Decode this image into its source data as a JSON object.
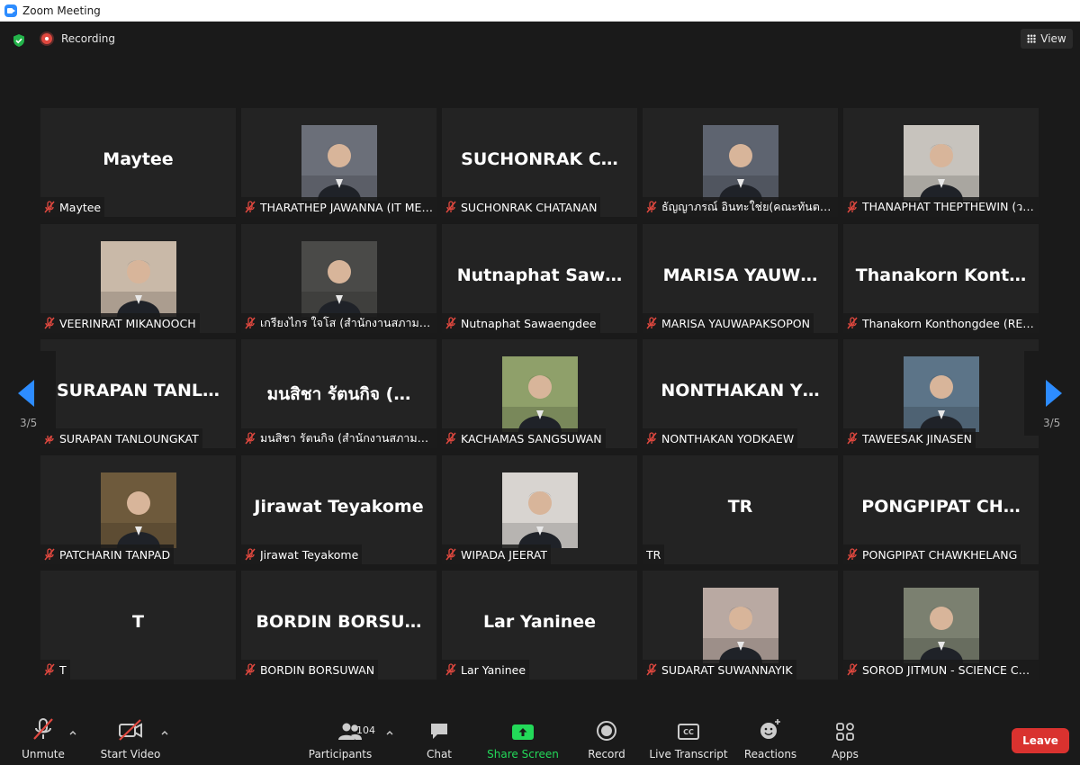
{
  "window": {
    "title": "Zoom Meeting"
  },
  "topbar": {
    "recording_label": "Recording",
    "view_label": "View"
  },
  "nav": {
    "page_left": "3/5",
    "page_right": "3/5"
  },
  "colors": {
    "accent": "#2D8CFF",
    "leave": "#d9322f",
    "mic_off": "#e0483f",
    "share": "#23d959"
  },
  "tiles": [
    {
      "display": "Maytee",
      "label": "Maytee"
    },
    {
      "display": "",
      "label": "THARATHEP JAWANNA (IT MED…",
      "photo": "#6b6f79"
    },
    {
      "display": "SUCHONRAK C…",
      "label": "SUCHONRAK CHATANAN"
    },
    {
      "display": "",
      "label": "ธัญญาภรณ์ อินทะใช่ย(คณะทันตแพ…",
      "photo": "#5e6470"
    },
    {
      "display": "",
      "label": "THANAPHAT THEPTHEWIN (วห…",
      "photo": "#c7c3bd"
    },
    {
      "display": "",
      "label": "VEERINRAT MIKANOOCH",
      "photo": "#c9b9a8"
    },
    {
      "display": "",
      "label": "เกรียงไกร ใจโส (สำนักงานสภามหาวิ…",
      "photo": "#4a4a48"
    },
    {
      "display": "Nutnaphat Saw…",
      "label": "Nutnaphat Sawaengdee"
    },
    {
      "display": "MARISA YAUW…",
      "label": "MARISA YAUWAPAKSOPON"
    },
    {
      "display": "Thanakorn Kont…",
      "label": "Thanakorn Konthongdee (REG)"
    },
    {
      "display": "SURAPAN TANL…",
      "label": "SURAPAN TANLOUNGKAT"
    },
    {
      "display": "มนสิชา รัตนกิจ (…",
      "label": "มนสิชา รัตนกิจ (สำนักงานสภามหาวิ…"
    },
    {
      "display": "",
      "label": "KACHAMAS SANGSUWAN",
      "photo": "#8fa06a"
    },
    {
      "display": "NONTHAKAN Y…",
      "label": "NONTHAKAN YODKAEW"
    },
    {
      "display": "",
      "label": "TAWEESAK JINASEN",
      "photo": "#5c7488"
    },
    {
      "display": "",
      "label": "PATCHARIN TANPAD",
      "photo": "#6e5a3c"
    },
    {
      "display": "Jirawat Teyakome",
      "label": "Jirawat Teyakome"
    },
    {
      "display": "",
      "label": "WIPADA JEERAT",
      "photo": "#d8d4d0"
    },
    {
      "display": "TR",
      "label": "TR",
      "muted": false
    },
    {
      "display": "PONGPIPAT CH…",
      "label": "PONGPIPAT CHAWKHELANG"
    },
    {
      "display": "T",
      "label": "T"
    },
    {
      "display": "BORDIN BORSU…",
      "label": "BORDIN BORSUWAN"
    },
    {
      "display": "Lar Yaninee",
      "label": "Lar Yaninee"
    },
    {
      "display": "",
      "label": "SUDARAT SUWANNAYIK",
      "photo": "#b9a9a2"
    },
    {
      "display": "",
      "label": "SOROD JITMUN - SCIENCE CMU",
      "photo": "#7b8070"
    }
  ],
  "toolbar": {
    "unmute": "Unmute",
    "start_video": "Start Video",
    "participants": "Participants",
    "participants_count": "104",
    "chat": "Chat",
    "share_screen": "Share Screen",
    "record": "Record",
    "live_transcript": "Live Transcript",
    "cc": "CC",
    "reactions": "Reactions",
    "apps": "Apps",
    "leave": "Leave"
  }
}
